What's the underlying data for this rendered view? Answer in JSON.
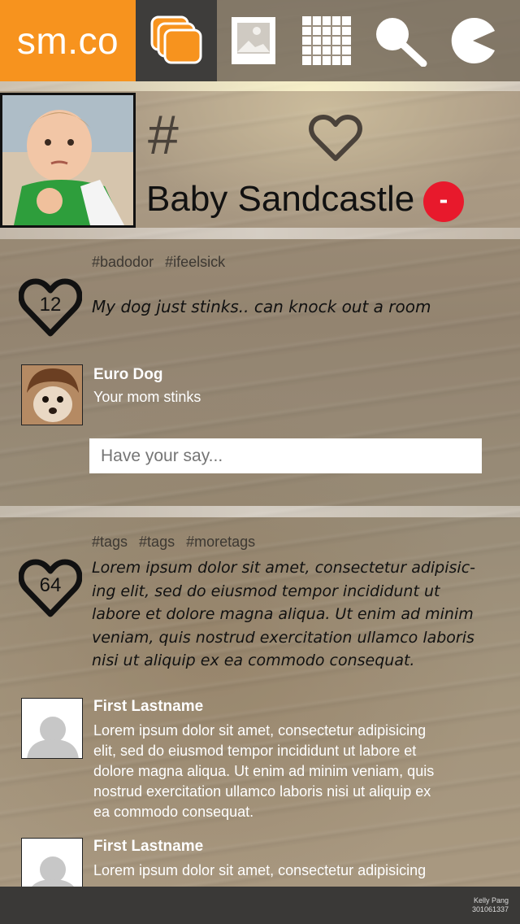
{
  "nav": {
    "logo": "sm.co",
    "items": [
      {
        "icon": "stack-icon",
        "active": true
      },
      {
        "icon": "image-icon",
        "active": false
      },
      {
        "icon": "calendar-icon",
        "active": false
      },
      {
        "icon": "search-icon",
        "active": false
      },
      {
        "icon": "pacman-icon",
        "active": false
      }
    ]
  },
  "profile": {
    "hash": "#",
    "name": "Baby Sandcastle",
    "remove_label": "-"
  },
  "posts": [
    {
      "tags": [
        "#badodor",
        "#ifeelsick"
      ],
      "likes": "12",
      "text": "My dog just stinks.. can knock out a room",
      "comments": [
        {
          "name": "Euro Dog",
          "text": "Your mom stinks"
        }
      ],
      "input_placeholder": "Have your say..."
    },
    {
      "tags": [
        "#tags",
        "#tags",
        "#moretags"
      ],
      "likes": "64",
      "text_lines": [
        "Lorem ipsum dolor sit amet, consectetur adipisic-",
        "ing elit, sed do eiusmod tempor incididunt ut",
        "labore et dolore magna aliqua. Ut enim ad minim",
        "veniam, quis nostrud exercitation ullamco laboris",
        "nisi ut aliquip ex ea commodo consequat."
      ],
      "comments": [
        {
          "name": "First Lastname",
          "text_lines": [
            "Lorem ipsum dolor sit amet, consectetur adipisicing",
            "elit, sed do eiusmod tempor incididunt ut labore et",
            "dolore magna aliqua. Ut enim ad minim veniam, quis",
            "nostrud exercitation ullamco laboris nisi ut aliquip ex",
            "ea commodo consequat."
          ]
        },
        {
          "name": "First Lastname",
          "text_lines": [
            "Lorem ipsum dolor sit amet, consectetur adipisicing"
          ]
        }
      ]
    }
  ],
  "footer": {
    "author": "Kelly Pang",
    "id": "301061337"
  },
  "colors": {
    "brand": "#f7931e",
    "active_nav": "#3e3d3b",
    "remove": "#e8192c",
    "footer": "#3a3937"
  }
}
